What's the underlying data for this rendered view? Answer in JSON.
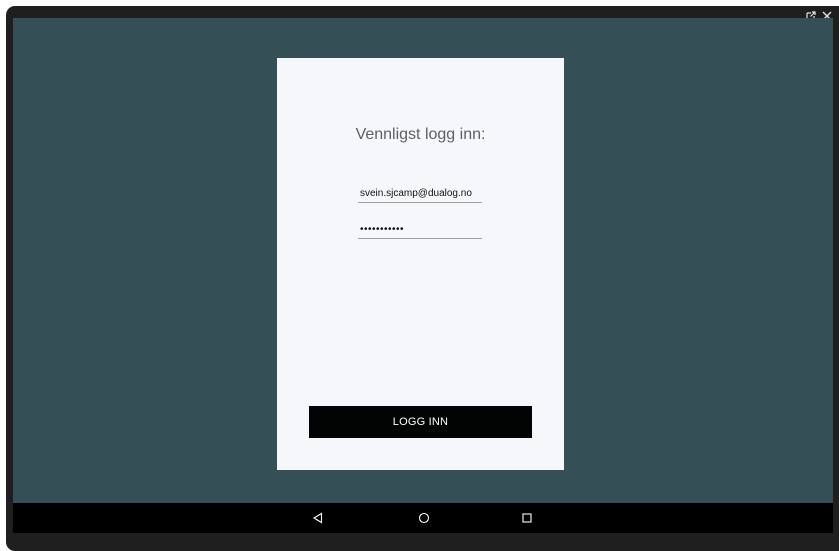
{
  "window": {
    "controls": [
      "external-window-icon",
      "close-icon"
    ]
  },
  "login": {
    "title": "Vennligst logg inn:",
    "email_value": "svein.sjcamp@dualog.no",
    "password_value": "•••••••••••",
    "button_label": "LOGG INN"
  },
  "navbar": {
    "icons": [
      "back-icon",
      "home-icon",
      "recents-icon"
    ]
  },
  "colors": {
    "background": "#344f55",
    "card": "#f5f7fa",
    "button": "#020404",
    "navbar": "#000000"
  }
}
